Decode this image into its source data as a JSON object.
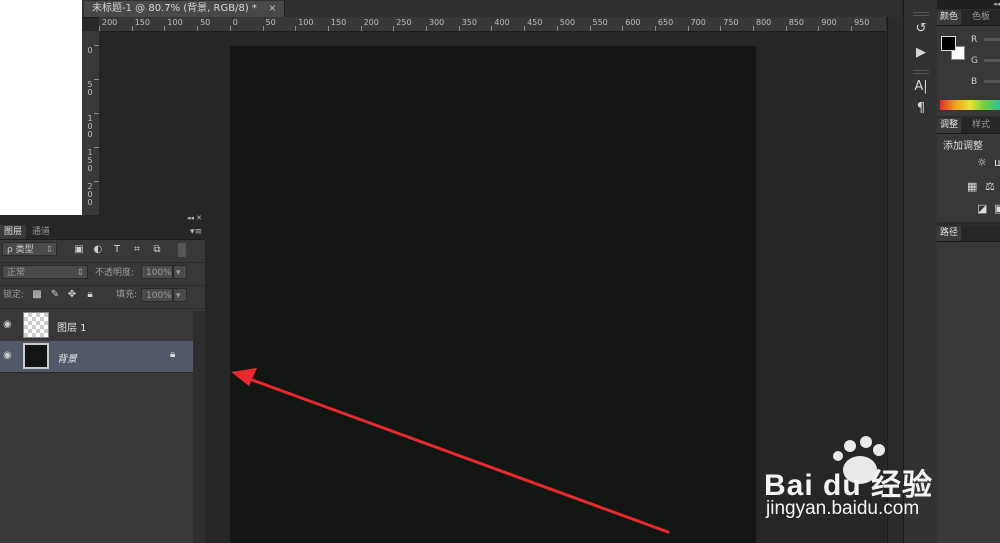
{
  "document": {
    "tab_title": "未标题-1 @ 80.7% (背景, RGB/8) *",
    "tab_close": "×",
    "ruler_top": [
      "200",
      "150",
      "100",
      "50",
      "0",
      "50",
      "100",
      "150",
      "200",
      "250",
      "300",
      "350",
      "400",
      "450",
      "500",
      "550",
      "600",
      "650",
      "700",
      "750",
      "800",
      "850",
      "900",
      "950"
    ],
    "ruler_left": [
      "0",
      "50",
      "100",
      "150",
      "200"
    ]
  },
  "right_panels": {
    "collapse_glyph": "◂◂",
    "color_tabs": [
      "颜色",
      "色板"
    ],
    "channels": [
      "R",
      "G",
      "B"
    ],
    "adjust_tabs": [
      "调整",
      "样式"
    ],
    "adjust_title": "添加调整",
    "paths_tab": "路径"
  },
  "layers_panel": {
    "header_glyphs": "◂◂  ✕",
    "tabs": [
      "图层",
      "通道"
    ],
    "filter_label": "ρ 类型",
    "blend_mode": "正常",
    "opacity_label": "不透明度:",
    "opacity_value": "100%",
    "lock_label": "锁定:",
    "fill_label": "填充:",
    "fill_value": "100%",
    "layers": [
      {
        "name": "图层 1"
      },
      {
        "name": "背景"
      }
    ]
  },
  "watermark": {
    "brand": "Bai du 经验",
    "url": "jingyan.baidu.com"
  },
  "colors": {
    "canvas": "#111612",
    "selected_layer": "#525a6a",
    "arrow": "#e8292e"
  }
}
